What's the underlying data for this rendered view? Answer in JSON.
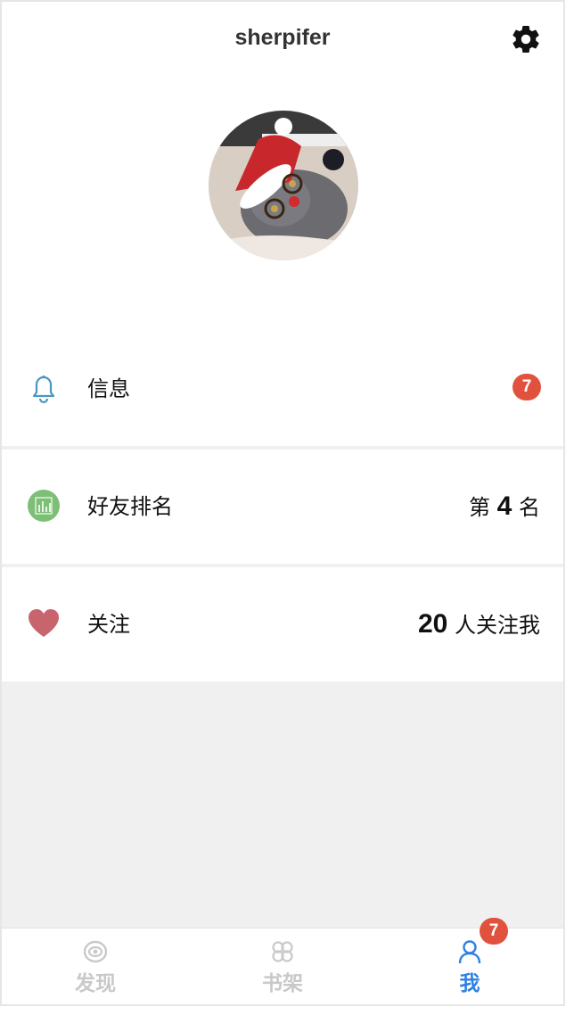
{
  "header": {
    "title": "sherpifer",
    "settings_icon": "gear-icon"
  },
  "profile": {
    "avatar_alt": ""
  },
  "rows": [
    {
      "label": "信息",
      "icon": "bell-icon",
      "badge": "7"
    },
    {
      "label": "好友排名",
      "icon": "ranking-chart-icon",
      "prefix": "第",
      "number": "4",
      "suffix": "名"
    },
    {
      "label": "关注",
      "icon": "heart-icon",
      "number": "20",
      "suffix": "人关注我"
    }
  ],
  "tabs": [
    {
      "label": "发现",
      "icon": "eye-icon",
      "active": false
    },
    {
      "label": "书架",
      "icon": "bookshelf-icon",
      "active": false
    },
    {
      "label": "我",
      "icon": "person-icon",
      "active": true,
      "badge": "7"
    }
  ],
  "colors": {
    "accent": "#2f80e3",
    "badge": "#e0523d",
    "bell": "#4a97c2",
    "rank": "#7dbf76",
    "heart": "#c8646e"
  }
}
